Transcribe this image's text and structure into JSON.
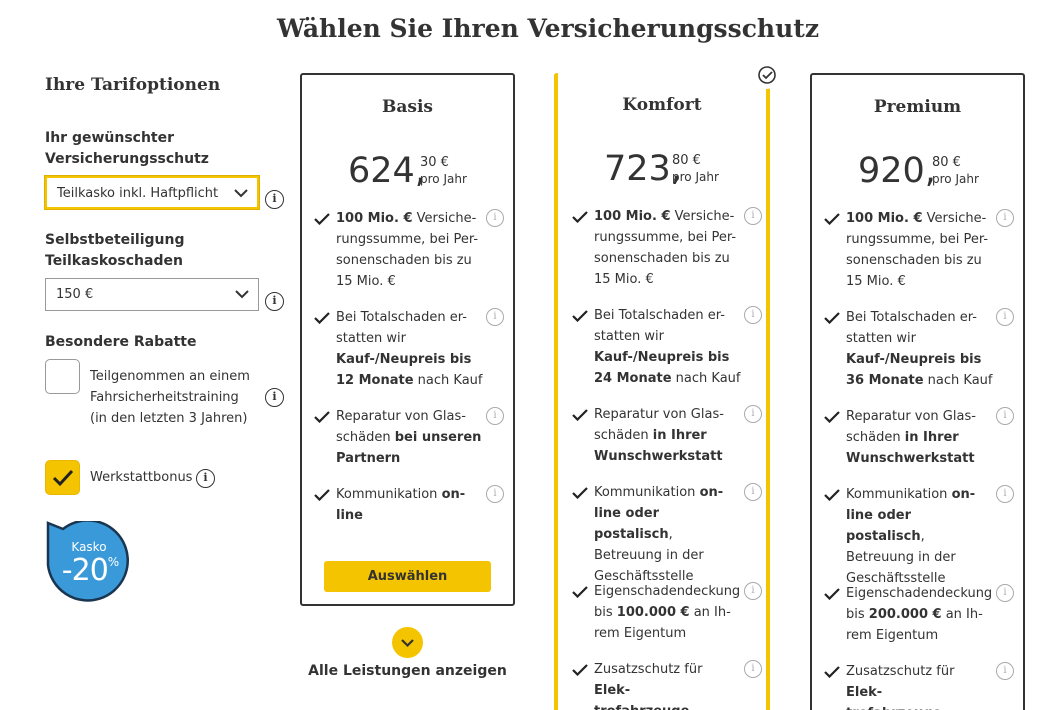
{
  "page": {
    "title": "Wählen Sie Ihren Versicherungsschutz"
  },
  "options": {
    "title": "Ihre Tarifoptionen",
    "coverage_label": "Ihr gewünschter Versicherungsschutz",
    "coverage_label_line1": "Ihr gewünschter",
    "coverage_label_line2": "Versicherungsschutz",
    "coverage_value": "Teilkasko inkl. Haftpflicht",
    "deductible_label_line1": "Selbstbeteiligung",
    "deductible_label_line2": "Teilkaskoschaden",
    "deductible_value": "150 €",
    "discounts_label": "Besondere Rabatte",
    "training_line1": "Teilgenommen an einem",
    "training_line2": "Fahrsicherheitstraining",
    "training_line3": "(in den letzten 3 Jahren)",
    "training_checked": false,
    "workshop_label": "Werkstattbonus",
    "workshop_checked": true,
    "info_glyph": "i"
  },
  "badge": {
    "top": "Kasko",
    "value": "-20",
    "sup": "%",
    "color": "#3a9ad9"
  },
  "colors": {
    "accent": "#f5c400",
    "text": "#333333"
  },
  "plans": [
    {
      "name": "Basis",
      "price_main": "624,",
      "price_cents": "30 €",
      "price_unit": "pro Jahr",
      "features": [
        [
          "<b>100 Mio. €</b> Versiche-",
          "rungssumme, bei Per-",
          "sonenschaden bis zu",
          "15 Mio. €"
        ],
        [
          "Bei Totalschaden er-",
          "statten wir",
          "<b>Kauf-/Neupreis bis</b>",
          "<b>12 Monate</b> nach Kauf"
        ],
        [
          "Reparatur von Glas-",
          "schäden <b>bei unseren</b>",
          "<b>Partnern</b>"
        ],
        [
          "Kommunikation <b>on-</b>",
          "<b>line</b>"
        ]
      ],
      "button": "Auswählen"
    },
    {
      "name": "Komfort",
      "price_main": "723,",
      "price_cents": "80 €",
      "price_unit": "pro Jahr",
      "features": [
        [
          "<b>100 Mio. €</b> Versiche-",
          "rungssumme, bei Per-",
          "sonenschaden bis zu",
          "15 Mio. €"
        ],
        [
          "Bei Totalschaden er-",
          "statten wir",
          "<b>Kauf-/Neupreis bis</b>",
          "<b>24 Monate</b> nach Kauf"
        ],
        [
          "Reparatur von Glas-",
          "schäden <b>in Ihrer</b>",
          "<b>Wunschwerkstatt</b>"
        ],
        [
          "Kommunikation <b>on-</b>",
          "<b>line oder postalisch</b>,",
          "Betreuung in der",
          "Geschäftsstelle"
        ],
        [
          "Eigenschadendeckung",
          "bis <b>100.000 €</b> an Ih-",
          "rem Eigentum"
        ],
        [
          "Zusatzschutz für <b>Elek-</b>",
          "<b>trofahrzeuge</b>"
        ]
      ]
    },
    {
      "name": "Premium",
      "price_main": "920,",
      "price_cents": "80 €",
      "price_unit": "pro Jahr",
      "features": [
        [
          "<b>100 Mio. €</b> Versiche-",
          "rungssumme, bei Per-",
          "sonenschaden bis zu",
          "15 Mio. €"
        ],
        [
          "Bei Totalschaden er-",
          "statten wir",
          "<b>Kauf-/Neupreis bis</b>",
          "<b>36 Monate</b> nach Kauf"
        ],
        [
          "Reparatur von Glas-",
          "schäden <b>in Ihrer</b>",
          "<b>Wunschwerkstatt</b>"
        ],
        [
          "Kommunikation <b>on-</b>",
          "<b>line oder postalisch</b>,",
          "Betreuung in der",
          "Geschäftsstelle"
        ],
        [
          "Eigenschadendeckung",
          "bis <b>200.000 €</b> an Ih-",
          "rem Eigentum"
        ],
        [
          "Zusatzschutz für <b>Elek-</b>",
          "<b>trofahrzeuge</b>"
        ]
      ]
    }
  ],
  "show_all": "Alle Leistungen anzeigen"
}
